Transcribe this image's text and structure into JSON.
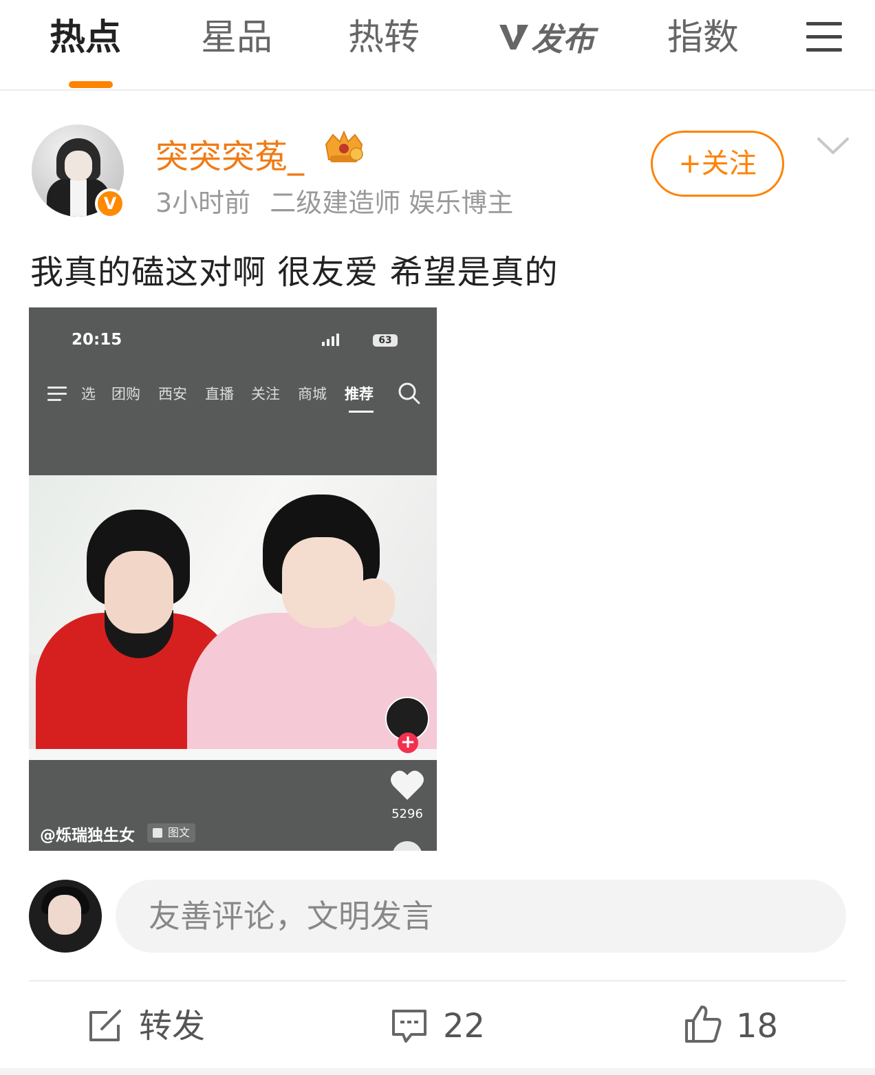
{
  "topnav": {
    "tabs": [
      {
        "label": "热点",
        "active": true
      },
      {
        "label": "星品",
        "active": false
      },
      {
        "label": "热转",
        "active": false
      },
      {
        "label": "发布",
        "active": false
      },
      {
        "label": "指数",
        "active": false
      }
    ],
    "accent": "#ff8200"
  },
  "post": {
    "username": "突突突菟_",
    "time": "3小时前",
    "source": "二级建造师 娱乐博主",
    "verified_badge": "V",
    "follow_label": "+关注",
    "text": "我真的磕这对啊 很友爱 希望是真的",
    "username_color": "#f07a14"
  },
  "screenshot": {
    "time": "20:15",
    "battery": "63",
    "tabs": [
      "选",
      "团购",
      "西安",
      "直播",
      "关注",
      "商城",
      "推荐"
    ],
    "active_tab": "推荐",
    "likes": "5296",
    "author": "@烁瑞独生女",
    "tag": "图文"
  },
  "comment": {
    "placeholder": "友善评论，文明发言"
  },
  "actions": {
    "repost_label": "转发",
    "comments_count": "22",
    "likes_count": "18"
  }
}
